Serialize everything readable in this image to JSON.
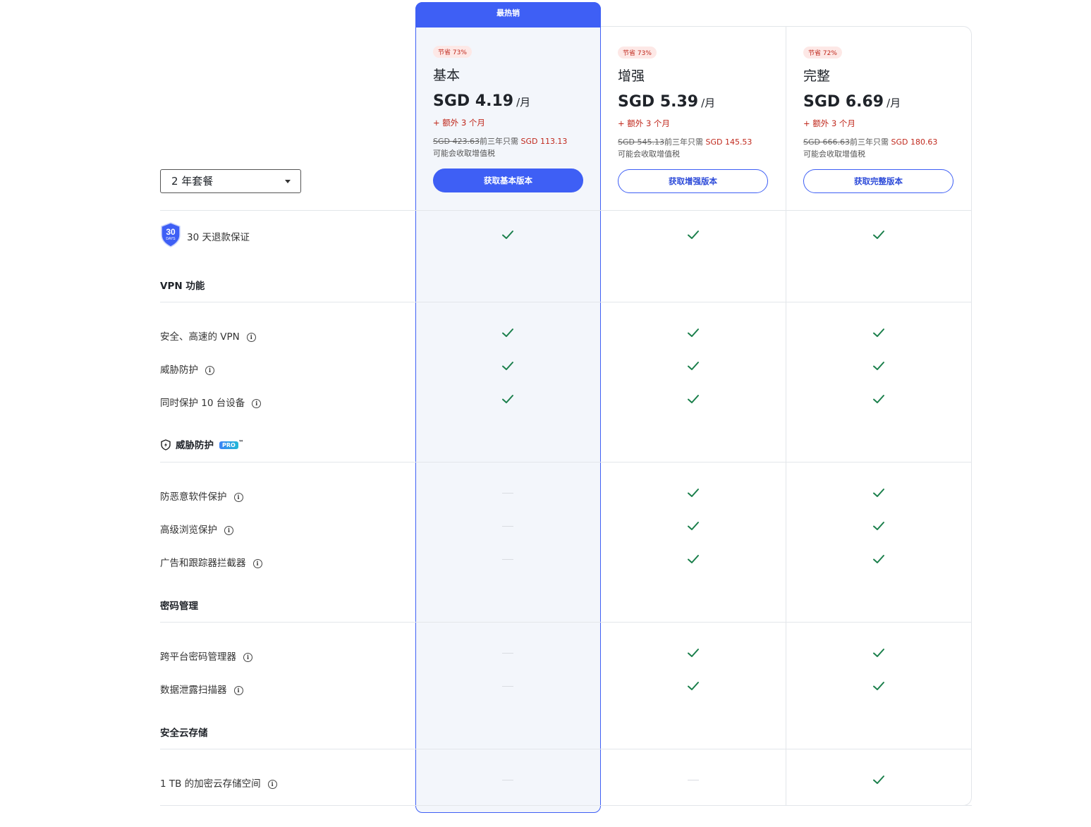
{
  "term_selector": {
    "value": "2 年套餐"
  },
  "plans": [
    {
      "id": "basic",
      "featured_label": "最热销",
      "save_badge": "节省 73%",
      "name": "基本",
      "price": "SGD 4.19",
      "per": "/月",
      "extra": "+ 额外 3 个月",
      "original_price": "SGD 423.63",
      "first_term_text": "前三年只需",
      "first_term_price": "SGD 113.13",
      "tax_note": "可能会收取增值税",
      "cta": "获取基本版本"
    },
    {
      "id": "advanced",
      "save_badge": "节省 73%",
      "name": "增强",
      "price": "SGD 5.39",
      "per": "/月",
      "extra": "+ 额外 3 个月",
      "original_price": "SGD 545.13",
      "first_term_text": "前三年只需",
      "first_term_price": "SGD 145.53",
      "tax_note": "可能会收取增值税",
      "cta": "获取增强版本"
    },
    {
      "id": "complete",
      "save_badge": "节省 72%",
      "name": "完整",
      "price": "SGD 6.69",
      "per": "/月",
      "extra": "+ 额外 3 个月",
      "original_price": "SGD 666.63",
      "first_term_text": "前三年只需",
      "first_term_price": "SGD 180.63",
      "tax_note": "可能会收取增值税",
      "cta": "获取完整版本"
    }
  ],
  "guarantee": {
    "badge_number": "30",
    "badge_unit": "DAYS",
    "label": "30 天退款保证",
    "availability": [
      true,
      true,
      true
    ]
  },
  "sections": [
    {
      "title": "VPN 功能",
      "features": [
        {
          "label": "安全、高速的 VPN",
          "availability": [
            true,
            true,
            true
          ]
        },
        {
          "label": "威胁防护",
          "availability": [
            true,
            true,
            true
          ]
        },
        {
          "label": "同时保护 10 台设备",
          "availability": [
            true,
            true,
            true
          ]
        }
      ]
    },
    {
      "title": "威胁防护",
      "badge": "PRO",
      "trademark": "™",
      "features": [
        {
          "label": "防恶意软件保护",
          "availability": [
            false,
            true,
            true
          ]
        },
        {
          "label": "高级浏览保护",
          "availability": [
            false,
            true,
            true
          ]
        },
        {
          "label": "广告和跟踪器拦截器",
          "availability": [
            false,
            true,
            true
          ]
        }
      ]
    },
    {
      "title": "密码管理",
      "features": [
        {
          "label": "跨平台密码管理器",
          "availability": [
            false,
            true,
            true
          ]
        },
        {
          "label": "数据泄露扫描器",
          "availability": [
            false,
            true,
            true
          ]
        }
      ]
    },
    {
      "title": "安全云存储",
      "features": [
        {
          "label": "1 TB 的加密云存储空间",
          "availability": [
            false,
            false,
            true
          ]
        }
      ]
    }
  ],
  "info_icon_glyph": "i",
  "colors": {
    "accent": "#3e5ff5",
    "check": "#1a7f4b",
    "sale": "#c0281c",
    "featured_bg": "#f3f6fb"
  }
}
